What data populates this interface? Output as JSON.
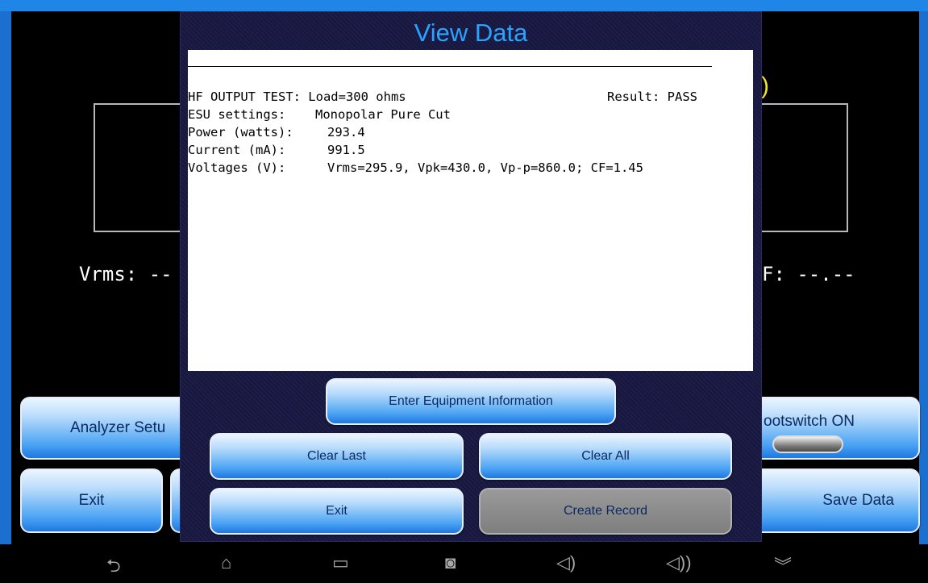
{
  "background": {
    "left_readout": "Vrms: --",
    "right_readout": "F: --.--",
    "yellow_glyph": ")",
    "buttons": {
      "analyzer_setup": "Analyzer Setu",
      "footswitch": "ootswitch ON",
      "exit": "Exit",
      "save_data": "Save Data"
    }
  },
  "dialog": {
    "title": "View Data",
    "report": {
      "test_line": "HF OUTPUT TEST: Load=300 ohms",
      "result": "Result: PASS",
      "esu_label": "ESU settings:",
      "esu_value": "Monopolar Pure Cut",
      "power_label": "Power (watts):",
      "power_value": "293.4",
      "current_label": "Current (mA):",
      "current_value": "991.5",
      "voltages_label": "Voltages (V):",
      "voltages_value": "Vrms=295.9, Vpk=430.0, Vp-p=860.0; CF=1.45"
    },
    "buttons": {
      "enter_equipment": "Enter Equipment Information",
      "clear_last": "Clear Last",
      "clear_all": "Clear All",
      "exit": "Exit",
      "create_record": "Create Record"
    }
  },
  "navbar": {
    "back": "⮌",
    "home": "⌂",
    "recents": "▭",
    "screenshot": "◙",
    "volume_down": "◁)",
    "volume_up": "◁))",
    "expand": "︾"
  },
  "colors": {
    "title": "#2aa3ff",
    "accent": "#1f86e8",
    "dialog_bg": "#1a1a44"
  }
}
